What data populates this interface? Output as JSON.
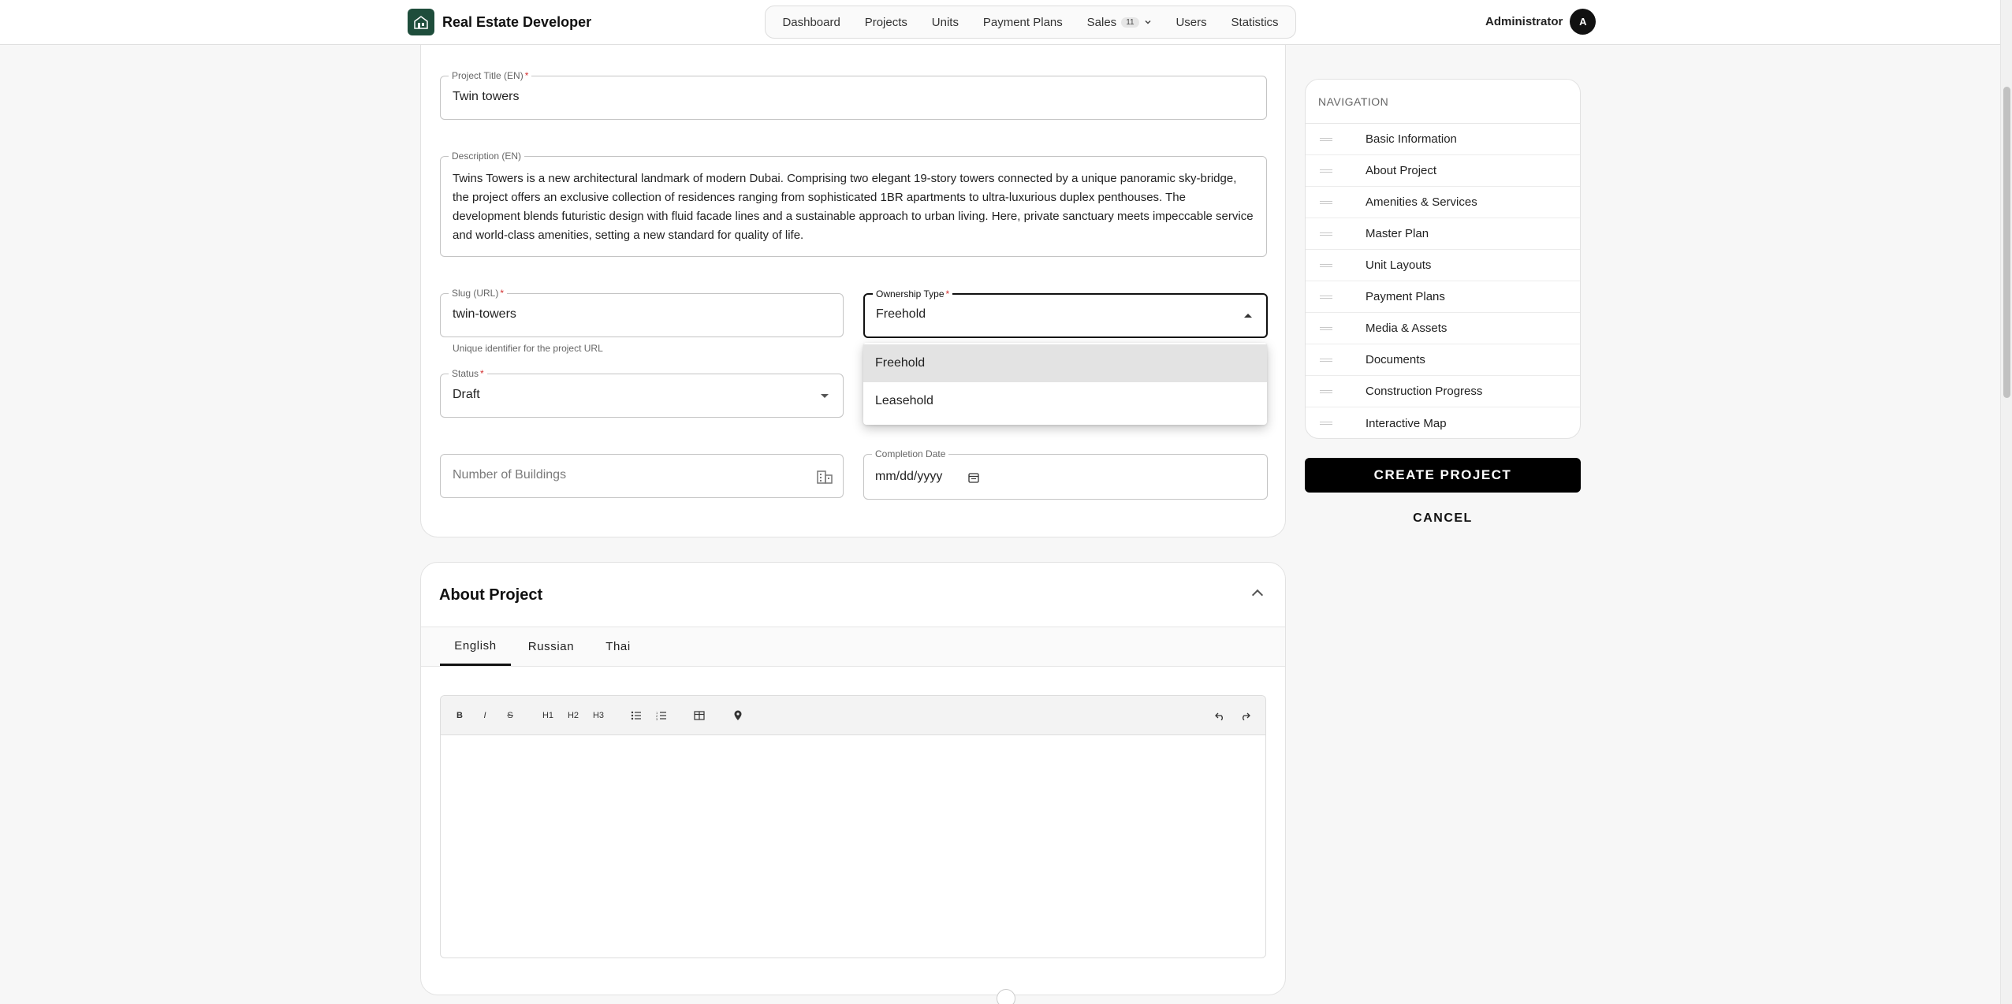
{
  "header": {
    "brand": "Real Estate Developer",
    "nav": [
      {
        "label": "Dashboard"
      },
      {
        "label": "Projects"
      },
      {
        "label": "Units"
      },
      {
        "label": "Payment Plans"
      },
      {
        "label": "Sales",
        "badge": "11"
      },
      {
        "label": "Users"
      },
      {
        "label": "Statistics"
      }
    ],
    "user_name": "Administrator",
    "avatar_initial": "A"
  },
  "form": {
    "project_title": {
      "label": "Project Title (EN)",
      "required": "*",
      "value": "Twin towers"
    },
    "description": {
      "label": "Description (EN)",
      "value": "Twins Towers is a new architectural landmark of modern Dubai. Comprising two elegant 19-story towers connected by a unique panoramic sky-bridge, the project offers an exclusive collection of residences ranging from sophisticated 1BR apartments to ultra-luxurious duplex penthouses. The development blends futuristic design with fluid facade lines and a sustainable approach to urban living. Here, private sanctuary meets impeccable service and world-class amenities, setting a new standard for quality of life."
    },
    "slug": {
      "label": "Slug (URL)",
      "required": "*",
      "value": "twin-towers",
      "helper": "Unique identifier for the project URL"
    },
    "ownership_type": {
      "label": "Ownership Type",
      "required": "*",
      "value": "Freehold",
      "options": [
        "Freehold",
        "Leasehold"
      ],
      "selected_option": "Freehold"
    },
    "status": {
      "label": "Status",
      "required": "*",
      "value": "Draft"
    },
    "buildings": {
      "placeholder": "Number of Buildings"
    },
    "completion_date": {
      "label": "Completion Date",
      "placeholder": "mm/dd/yyyy"
    }
  },
  "about": {
    "title": "About Project",
    "tabs": [
      "English",
      "Russian",
      "Thai"
    ],
    "active_tab": "English",
    "toolbar": [
      "B",
      "I",
      "S",
      "H1",
      "H2",
      "H3",
      "bullet-list-icon",
      "ordered-list-icon",
      "table-icon",
      "location-pin-icon",
      "undo-icon",
      "redo-icon"
    ]
  },
  "sidebar": {
    "title": "NAVIGATION",
    "items": [
      {
        "label": "Basic Information"
      },
      {
        "label": "About Project"
      },
      {
        "label": "Amenities & Services"
      },
      {
        "label": "Master Plan"
      },
      {
        "label": "Unit Layouts"
      },
      {
        "label": "Payment Plans"
      },
      {
        "label": "Media & Assets"
      },
      {
        "label": "Documents"
      },
      {
        "label": "Construction Progress"
      },
      {
        "label": "Interactive Map"
      }
    ],
    "create_label": "CREATE PROJECT",
    "cancel_label": "CANCEL"
  },
  "colors": {
    "brand_logo": "#1e4d3b",
    "primary_button": "#000000",
    "required_star": "#d32f2f"
  }
}
